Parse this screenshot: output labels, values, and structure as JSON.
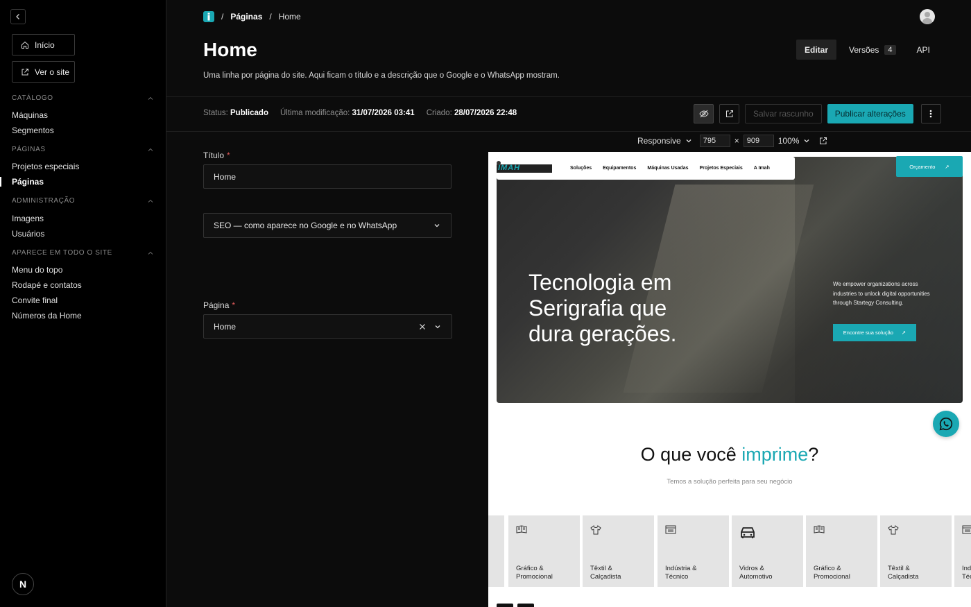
{
  "sidebar": {
    "home_label": "Início",
    "site_label": "Ver o site",
    "sections": [
      {
        "title": "CATÁLOGO",
        "items": [
          "Máquinas",
          "Segmentos"
        ]
      },
      {
        "title": "PÁGINAS",
        "items": [
          "Projetos especiais",
          "Páginas"
        ]
      },
      {
        "title": "ADMINISTRAÇÃO",
        "items": [
          "Imagens",
          "Usuários"
        ]
      },
      {
        "title": "APARECE EM TODO O SITE",
        "items": [
          "Menu do topo",
          "Rodapé e contatos",
          "Convite final",
          "Números da Home"
        ]
      }
    ],
    "logo_letter": "N"
  },
  "breadcrumb": {
    "sep": "/",
    "section": "Páginas",
    "current": "Home"
  },
  "header": {
    "title": "Home",
    "description": "Uma linha por página do site. Aqui ficam o título e a descrição que o Google e o WhatsApp mostram.",
    "tabs": {
      "edit": "Editar",
      "versions": "Versões",
      "versions_count": "4",
      "api": "API"
    }
  },
  "status": {
    "status_label": "Status:",
    "status_value": "Publicado",
    "modified_label": "Última modificação:",
    "modified_value": "31/07/2026 03:41",
    "created_label": "Criado:",
    "created_value": "28/07/2026 22:48"
  },
  "actions": {
    "draft": "Salvar rascunho",
    "publish": "Publicar alterações"
  },
  "form": {
    "title_label": "Título",
    "required": "*",
    "title_value": "Home",
    "seo_label": "SEO — como aparece no Google e no WhatsApp",
    "page_label": "Página",
    "page_value": "Home"
  },
  "preview_bar": {
    "mode": "Responsive",
    "width": "795",
    "times": "×",
    "height": "909",
    "zoom": "100%"
  },
  "preview": {
    "logo": "IMAH",
    "nav": [
      "Soluções",
      "Equipamentos",
      "Máquinas Usadas",
      "Projetos Especiais",
      "A Imah"
    ],
    "cta": "Orçamento",
    "hero_title": "Tecnologia em Serigrafia que dura gerações.",
    "hero_text": "We empower organizations across industries to unlock digital opportunities through Startegy Consulting.",
    "hero_button": "Encontre sua solução",
    "section_title_pre": "O que você ",
    "section_title_accent": "imprime",
    "section_title_post": "?",
    "section_sub": "Temos a solução perfeita para seu negócio",
    "cards": [
      {
        "l1": "",
        "l2": "",
        "icon": "print-icon"
      },
      {
        "l1": "Gráfico &",
        "l2": "Promocional",
        "icon": "print-icon"
      },
      {
        "l1": "Têxtil &",
        "l2": "Calçadista",
        "icon": "shirt-icon"
      },
      {
        "l1": "Indústria &",
        "l2": "Técnico",
        "icon": "panel-icon"
      },
      {
        "l1": "Vidros &",
        "l2": "Automotivo",
        "icon": "car-icon"
      },
      {
        "l1": "Gráfico &",
        "l2": "Promocional",
        "icon": "print-icon"
      },
      {
        "l1": "Têxtil &",
        "l2": "Calçadista",
        "icon": "shirt-icon"
      },
      {
        "l1": "Ind",
        "l2": "Téc",
        "icon": "panel-icon"
      }
    ]
  },
  "colors": {
    "accent": "#1aa8b3",
    "bg": "#0c0c0c",
    "sidebar": "#000000"
  }
}
